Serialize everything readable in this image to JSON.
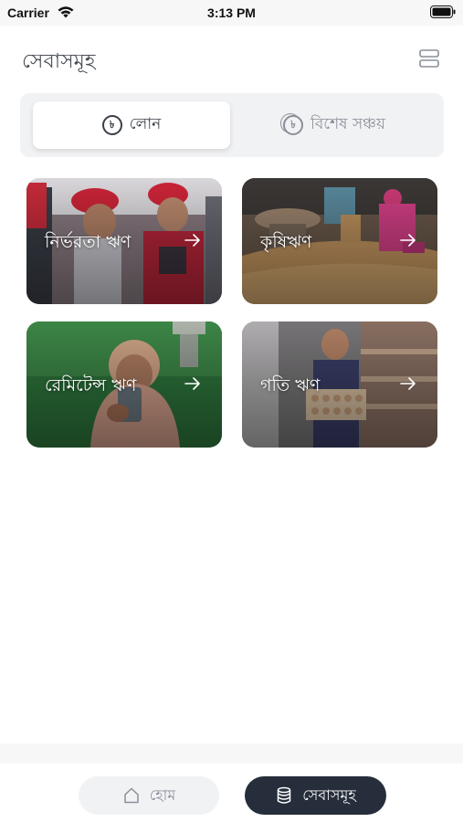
{
  "status_bar": {
    "carrier": "Carrier",
    "time": "3:13 PM"
  },
  "header": {
    "title": "সেবাসমূহ",
    "menu_icon": "menu-stack-icon"
  },
  "segment": {
    "tabs": [
      {
        "label": "লোন",
        "icon": "taka-icon",
        "active": true
      },
      {
        "label": "বিশেষ সঞ্চয়",
        "icon": "taka-stack-icon",
        "active": false
      }
    ]
  },
  "cards": [
    {
      "label": "নির্ভরতা ঋণ",
      "icon": "arrow-right-icon"
    },
    {
      "label": "কৃষিঋণ",
      "icon": "arrow-right-icon"
    },
    {
      "label": "রেমিটেন্স ঋণ",
      "icon": "arrow-right-icon"
    },
    {
      "label": "গতি ঋণ",
      "icon": "arrow-right-icon"
    }
  ],
  "bottom_nav": {
    "home_label": "হোম",
    "services_label": "সেবাসমূহ"
  },
  "colors": {
    "accent_dark": "#252e3a",
    "segment_bg": "#f1f2f4"
  }
}
